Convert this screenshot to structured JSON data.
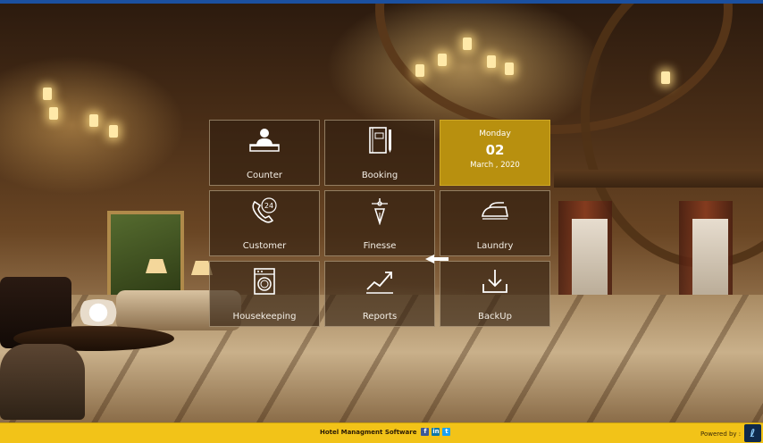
{
  "tiles": [
    {
      "label": "Counter",
      "icon": "reception-desk-icon"
    },
    {
      "label": "Booking",
      "icon": "notebook-pen-icon"
    },
    {
      "label": "Customer",
      "icon": "phone-24-icon"
    },
    {
      "label": "Finesse",
      "icon": "pen-nib-icon"
    },
    {
      "label": "Laundry",
      "icon": "iron-icon"
    },
    {
      "label": "Housekeeping",
      "icon": "washing-machine-icon"
    },
    {
      "label": "Reports",
      "icon": "trend-chart-icon"
    },
    {
      "label": "BackUp",
      "icon": "download-icon"
    }
  ],
  "date": {
    "day": "Monday",
    "number": "02",
    "month_year": "March , 2020"
  },
  "customer_icon_text": "24",
  "footer": {
    "title": "Hotel Managment Software",
    "social": [
      {
        "glyph": "f",
        "icon": "facebook-icon"
      },
      {
        "glyph": "in",
        "icon": "linkedin-icon"
      },
      {
        "glyph": "t",
        "icon": "twitter-icon"
      }
    ],
    "powered_by": "Powered by :"
  },
  "colors": {
    "accent_gold": "#b8900f",
    "footer_yellow": "#f2c318",
    "tile_border": "#d7c3a0"
  }
}
